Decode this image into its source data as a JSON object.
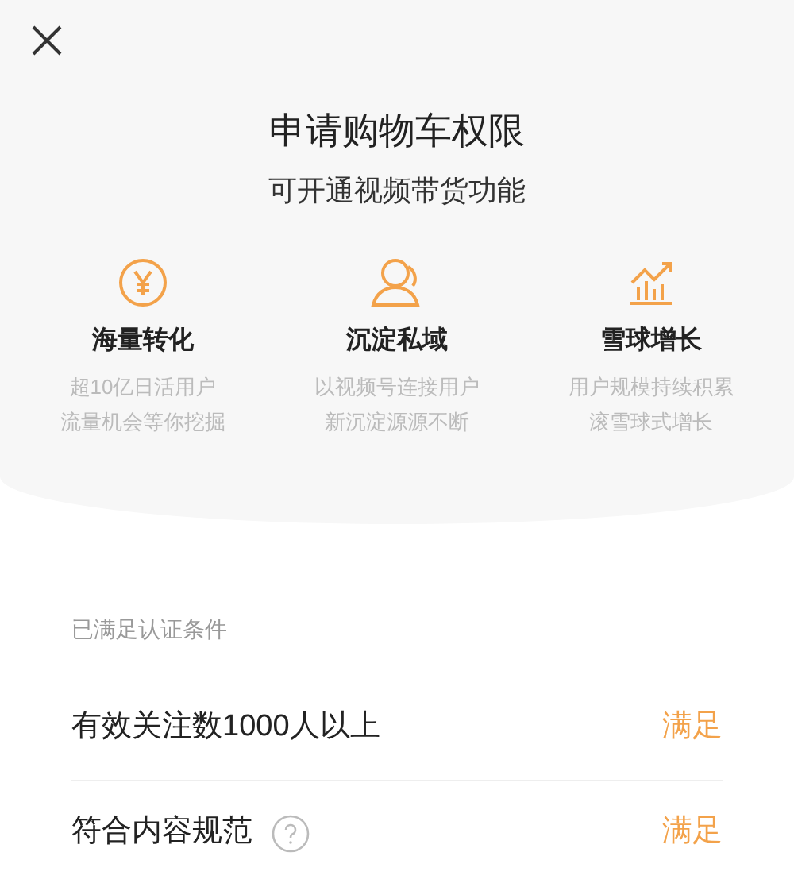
{
  "header": {
    "title": "申请购物车权限",
    "subtitle": "可开通视频带货功能"
  },
  "features": [
    {
      "kind": "yuan",
      "title": "海量转化",
      "lines": [
        "超10亿日活用户",
        "流量机会等你挖掘"
      ]
    },
    {
      "kind": "people",
      "title": "沉淀私域",
      "lines": [
        "以视频号连接用户",
        "新沉淀源源不断"
      ]
    },
    {
      "kind": "growth",
      "title": "雪球增长",
      "lines": [
        "用户规模持续积累",
        "滚雪球式增长"
      ]
    }
  ],
  "conditions": {
    "label": "已满足认证条件",
    "rows": [
      {
        "text": "有效关注数1000人以上",
        "help": false,
        "status": "满足"
      },
      {
        "text": "符合内容规范",
        "help": true,
        "status": "满足"
      }
    ]
  }
}
